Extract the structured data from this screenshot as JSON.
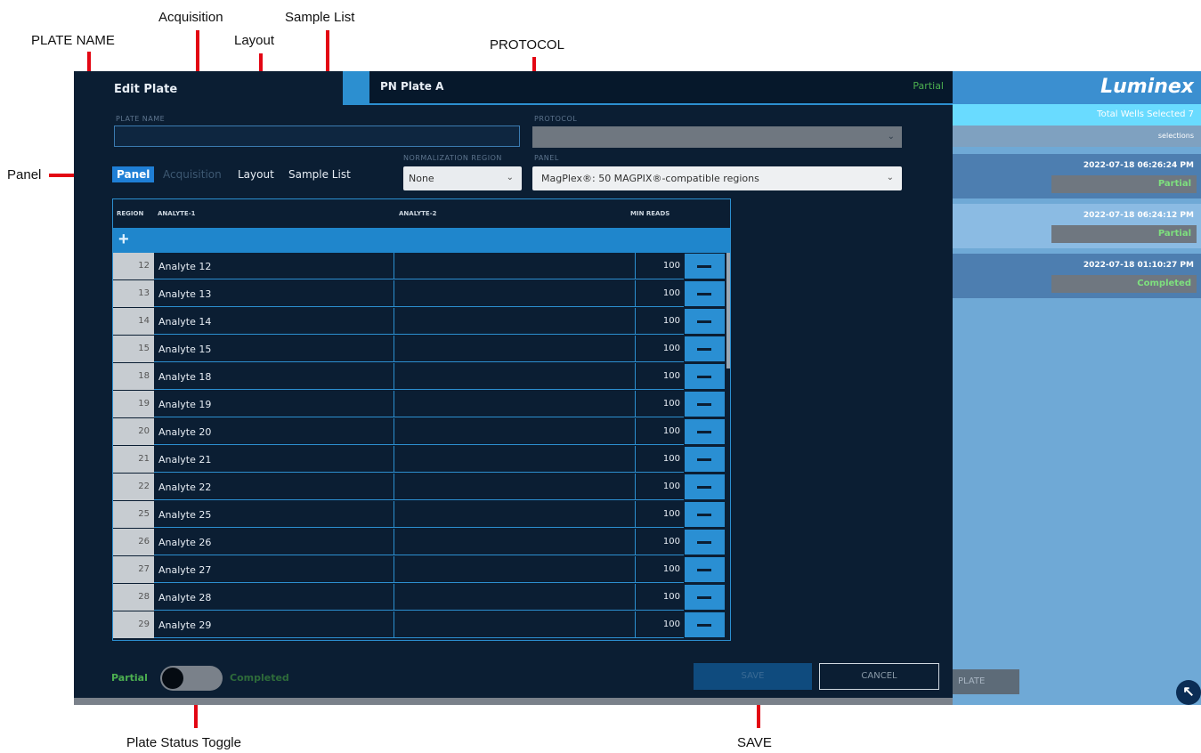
{
  "annotations": {
    "plate_name": "PLATE NAME",
    "acquisition": "Acquisition",
    "layout": "Layout",
    "sample_list": "Sample List",
    "protocol": "PROTOCOL",
    "panel": "Panel",
    "plate_status_toggle": "Plate Status Toggle",
    "save": "SAVE",
    "arrow_color": "#e30613"
  },
  "app": {
    "title": "Edit Plate",
    "plate_tab": {
      "name": "PN Plate A",
      "status": "Partial"
    },
    "fields": {
      "plate_name_label": "PLATE NAME",
      "plate_name_value": "",
      "protocol_label": "PROTOCOL",
      "protocol_value": "",
      "normalization_label": "NORMALIZATION REGION",
      "normalization_value": "None",
      "panel_label": "PANEL",
      "panel_value": "MagPlex®: 50 MAGPIX®-compatible regions"
    },
    "tabs": {
      "panel": "Panel",
      "acquisition": "Acquisition",
      "layout": "Layout",
      "sample_list": "Sample List"
    },
    "grid": {
      "headers": {
        "region": "REGION",
        "analyte1": "ANALYTE-1",
        "analyte2": "ANALYTE-2",
        "min_reads": "MIN READS"
      },
      "add_icon": "plus-icon",
      "rows": [
        {
          "region": "12",
          "analyte1": "Analyte 12",
          "analyte2": "",
          "min_reads": "100"
        },
        {
          "region": "13",
          "analyte1": "Analyte 13",
          "analyte2": "",
          "min_reads": "100"
        },
        {
          "region": "14",
          "analyte1": "Analyte 14",
          "analyte2": "",
          "min_reads": "100"
        },
        {
          "region": "15",
          "analyte1": "Analyte 15",
          "analyte2": "",
          "min_reads": "100"
        },
        {
          "region": "18",
          "analyte1": "Analyte 18",
          "analyte2": "",
          "min_reads": "100"
        },
        {
          "region": "19",
          "analyte1": "Analyte 19",
          "analyte2": "",
          "min_reads": "100"
        },
        {
          "region": "20",
          "analyte1": "Analyte 20",
          "analyte2": "",
          "min_reads": "100"
        },
        {
          "region": "21",
          "analyte1": "Analyte 21",
          "analyte2": "",
          "min_reads": "100"
        },
        {
          "region": "22",
          "analyte1": "Analyte 22",
          "analyte2": "",
          "min_reads": "100"
        },
        {
          "region": "25",
          "analyte1": "Analyte 25",
          "analyte2": "",
          "min_reads": "100"
        },
        {
          "region": "26",
          "analyte1": "Analyte 26",
          "analyte2": "",
          "min_reads": "100"
        },
        {
          "region": "27",
          "analyte1": "Analyte 27",
          "analyte2": "",
          "min_reads": "100"
        },
        {
          "region": "28",
          "analyte1": "Analyte 28",
          "analyte2": "",
          "min_reads": "100"
        },
        {
          "region": "29",
          "analyte1": "Analyte 29",
          "analyte2": "",
          "min_reads": "100"
        }
      ]
    },
    "footer": {
      "partial_label": "Partial",
      "completed_label": "Completed",
      "save_label": "SAVE",
      "cancel_label": "CANCEL"
    },
    "sidebar": {
      "logo": "Luminex",
      "total_wells": "Total Wells Selected 7",
      "sort_label": "selections",
      "items": [
        {
          "timestamp": "2022-07-18 06:26:24 PM",
          "status": "Partial"
        },
        {
          "timestamp": "2022-07-18 06:24:12 PM",
          "status": "Partial"
        },
        {
          "timestamp": "2022-07-18 01:10:27 PM",
          "status": "Completed"
        }
      ],
      "plate_button": "PLATE"
    },
    "colors": {
      "background": "#0b1e33",
      "accent": "#2c8fd0",
      "partial": "#4caf50",
      "sidebar": "#6fa9d6"
    }
  }
}
